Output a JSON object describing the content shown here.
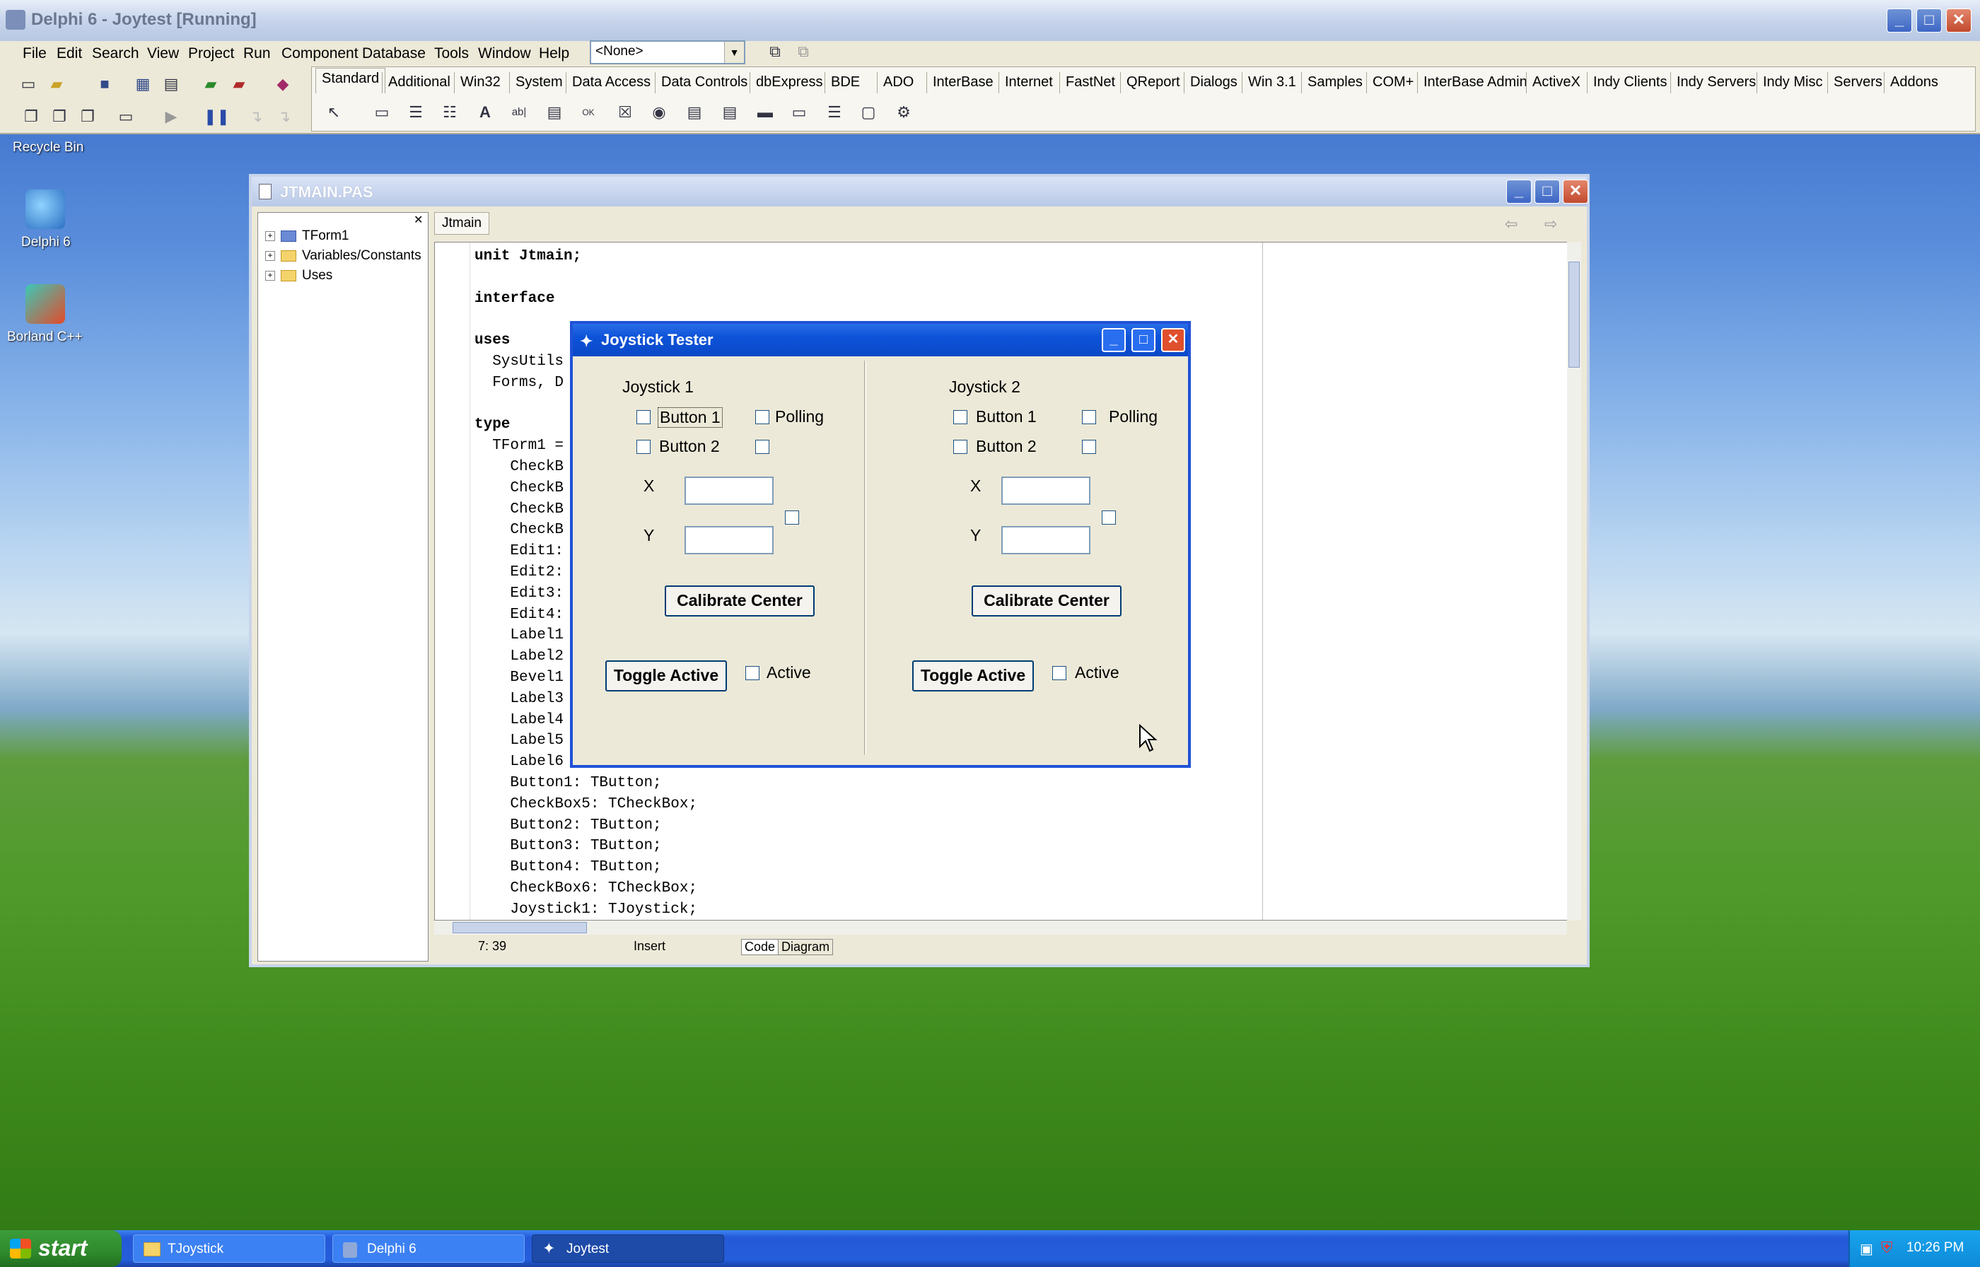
{
  "ide": {
    "title": "Delphi 6 - Joytest [Running]",
    "menu": [
      "File",
      "Edit",
      "Search",
      "View",
      "Project",
      "Run",
      "Component",
      "Database",
      "Tools",
      "Window",
      "Help"
    ],
    "combo_value": "<None>",
    "palette_tabs": [
      "Standard",
      "Additional",
      "Win32",
      "System",
      "Data Access",
      "Data Controls",
      "dbExpress",
      "BDE",
      "ADO",
      "InterBase",
      "Internet",
      "FastNet",
      "QReport",
      "Dialogs",
      "Win 3.1",
      "Samples",
      "COM+",
      "InterBase Admin",
      "ActiveX",
      "Indy Clients",
      "Indy Servers",
      "Indy Misc",
      "Servers",
      "Addons"
    ]
  },
  "desktop": {
    "recycle_bin": "Recycle Bin",
    "icons": [
      "Delphi 6",
      "Borland C++"
    ]
  },
  "editor": {
    "title": "JTMAIN.PAS",
    "tree": [
      "TForm1",
      "Variables/Constants",
      "Uses"
    ],
    "tab": "Jtmain",
    "code_lines": [
      [
        "unit Jtmain;",
        true
      ],
      [
        "",
        false
      ],
      [
        "interface",
        true
      ],
      [
        "",
        false
      ],
      [
        "uses",
        true
      ],
      [
        "  SysUtils",
        false
      ],
      [
        "  Forms, D",
        false
      ],
      [
        "",
        false
      ],
      [
        "type",
        true
      ],
      [
        "  TForm1 =",
        false
      ],
      [
        "    CheckB",
        false
      ],
      [
        "    CheckB",
        false
      ],
      [
        "    CheckB",
        false
      ],
      [
        "    CheckB",
        false
      ],
      [
        "    Edit1:",
        false
      ],
      [
        "    Edit2:",
        false
      ],
      [
        "    Edit3:",
        false
      ],
      [
        "    Edit4:",
        false
      ],
      [
        "    Label1",
        false
      ],
      [
        "    Label2",
        false
      ],
      [
        "    Bevel1",
        false
      ],
      [
        "    Label3",
        false
      ],
      [
        "    Label4",
        false
      ],
      [
        "    Label5",
        false
      ],
      [
        "    Label6",
        false
      ],
      [
        "    Button1: TButton;",
        false
      ],
      [
        "    CheckBox5: TCheckBox;",
        false
      ],
      [
        "    Button2: TButton;",
        false
      ],
      [
        "    Button3: TButton;",
        false
      ],
      [
        "    Button4: TButton;",
        false
      ],
      [
        "    CheckBox6: TCheckBox;",
        false
      ],
      [
        "    Joystick1: TJoystick;",
        false
      ]
    ],
    "status_pos": "7: 39",
    "status_mode": "Insert",
    "bottom_tabs": [
      "Code",
      "Diagram"
    ]
  },
  "dialog": {
    "title": "Joystick Tester",
    "left": {
      "heading": "Joystick 1",
      "button1": "Button 1",
      "button2": "Button 2",
      "polling": "Polling",
      "x": "X",
      "y": "Y",
      "calibrate": "Calibrate Center",
      "toggle": "Toggle Active",
      "active": "Active"
    },
    "right": {
      "heading": "Joystick 2",
      "button1": "Button 1",
      "button2": "Button 2",
      "polling": "Polling",
      "x": "X",
      "y": "Y",
      "calibrate": "Calibrate Center",
      "toggle": "Toggle Active",
      "active": "Active"
    }
  },
  "taskbar": {
    "start": "start",
    "tasks": [
      "TJoystick",
      "Delphi 6",
      "Joytest"
    ],
    "clock": "10:26 PM"
  }
}
